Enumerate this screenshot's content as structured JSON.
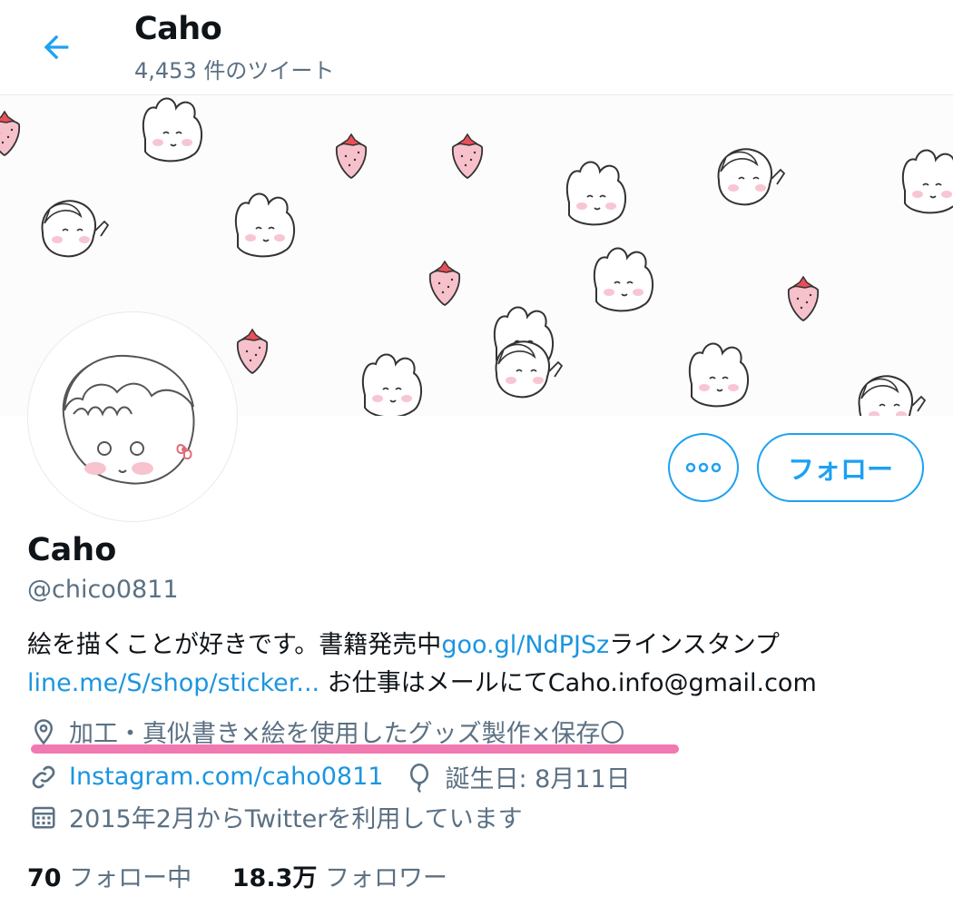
{
  "header": {
    "back_icon": "arrow-left-icon",
    "title": "Caho",
    "tweet_count": "4,453 件のツイート"
  },
  "actions": {
    "more_icon": "more-options-icon",
    "follow_label": "フォロー"
  },
  "profile": {
    "name": "Caho",
    "handle": "@chico0811",
    "bio": {
      "text1": "絵を描くことが好きです。書籍発売中",
      "link1": "goo.gl/NdPJSz",
      "text2": "ラインスタンプ",
      "link2": "line.me/S/shop/sticker...",
      "text3": " お仕事はメールにてCaho.info@gmail.com"
    },
    "location": {
      "icon": "location-pin-icon",
      "text": "加工・真似書き×絵を使用したグッズ製作×保存〇"
    },
    "website": {
      "icon": "link-icon",
      "text": "Instagram.com/caho0811"
    },
    "birthday": {
      "icon": "balloon-icon",
      "text": "誕生日: 8月11日"
    },
    "joined": {
      "icon": "calendar-icon",
      "text": "2015年2月からTwitterを利用しています"
    }
  },
  "stats": {
    "following_count": "70",
    "following_label": "フォロー中",
    "followers_count": "18.3万",
    "followers_label": "フォロワー"
  },
  "colors": {
    "accent": "#1da1f2",
    "link": "#1b95e0",
    "secondary_text": "#5b7083",
    "highlight_underline": "#f06aa8"
  }
}
